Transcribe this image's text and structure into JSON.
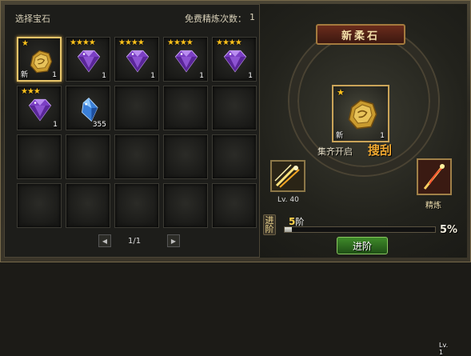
{
  "left_panel": {
    "title": "选择宝石",
    "free_label": "免费精炼次数：",
    "free_count": "1",
    "slots": [
      {
        "type": "gold-stone",
        "stars": "★",
        "qty": "1",
        "new": "新",
        "selected": true
      },
      {
        "type": "purple-gem",
        "stars": "★★★★",
        "qty": "1"
      },
      {
        "type": "purple-gem",
        "stars": "★★★★",
        "qty": "1"
      },
      {
        "type": "purple-gem",
        "stars": "★★★★",
        "qty": "1"
      },
      {
        "type": "purple-gem",
        "stars": "★★★★",
        "qty": "1"
      },
      {
        "type": "purple-gem",
        "stars": "★★★",
        "qty": "1"
      },
      {
        "type": "blue-crystal",
        "stars": "",
        "qty": "355"
      },
      {},
      {},
      {},
      {},
      {},
      {},
      {},
      {},
      {},
      {},
      {},
      {},
      {}
    ],
    "pager": {
      "text": "1/1",
      "prev_icon": "prev-arrow-icon",
      "next_icon": "next-arrow-icon"
    }
  },
  "right_panel": {
    "title": "新柔石",
    "main_slot": {
      "stars": "★",
      "new": "新",
      "qty": "1"
    },
    "unlock_text": "集齐开启",
    "unlock_skill": "搜刮",
    "skill_level": "Lv. 40",
    "refine": {
      "level": "Lv. 1",
      "label": "精炼"
    },
    "advance_label": "进阶",
    "stage_num": "5",
    "stage_suffix": "阶",
    "progress": 0.05,
    "progress_text": "5%",
    "advance_button": "进阶"
  }
}
